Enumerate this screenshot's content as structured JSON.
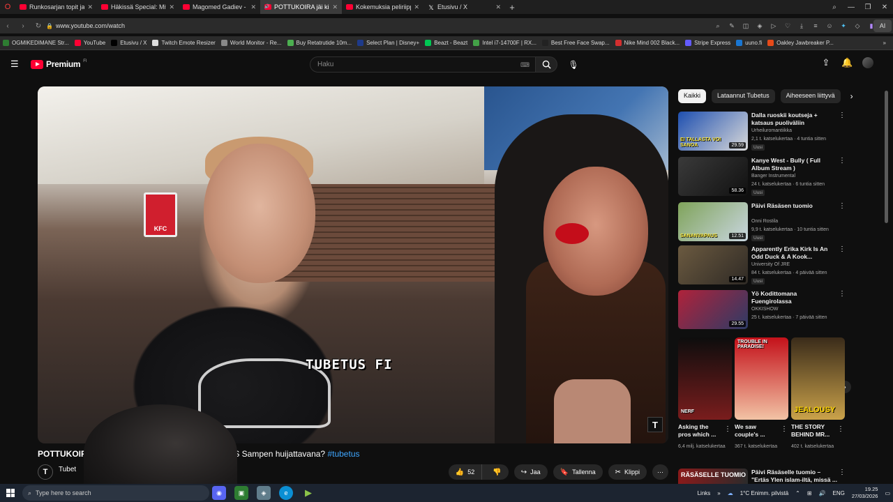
{
  "browser": {
    "tabs": [
      {
        "title": "Runkosarjan topit ja flopit",
        "favicon": "red"
      },
      {
        "title": "Häkissä Special: Mitä oikei",
        "favicon": "red"
      },
      {
        "title": "Magomed Gadiev - YouTub",
        "favicon": "red"
      },
      {
        "title": "POTTUKOIRA jäi kiinni",
        "favicon": "speaker",
        "active": true
      },
      {
        "title": "Kokemuksia peliriippuvuu",
        "favicon": "red"
      },
      {
        "title": "Etusivu / X",
        "favicon": "x"
      }
    ],
    "url": "www.youtube.com/watch",
    "ai_label": "AI",
    "bookmarks": [
      {
        "label": "OGMIKEDIMANE Str...",
        "color": "#2e7d32"
      },
      {
        "label": "YouTube",
        "color": "#ff0033"
      },
      {
        "label": "Etusivu / X",
        "color": "#000000"
      },
      {
        "label": "Twitch Emote Resizer",
        "color": "#dddddd"
      },
      {
        "label": "World Monitor - Re...",
        "color": "#888888"
      },
      {
        "label": "Buy Retatrutide 10m...",
        "color": "#4caf50"
      },
      {
        "label": "Select Plan | Disney+",
        "color": "#1e3a8a"
      },
      {
        "label": "Beazt - Beazt",
        "color": "#00c853"
      },
      {
        "label": "Intel i7-14700F | RX...",
        "color": "#43a047"
      },
      {
        "label": "Best Free Face Swap...",
        "color": "#222222"
      },
      {
        "label": "Nike Mind 002 Black...",
        "color": "#d32f2f"
      },
      {
        "label": "Stripe Express",
        "color": "#635bff"
      },
      {
        "label": "uuno.fi",
        "color": "#1976d2"
      },
      {
        "label": "Oakley Jawbreaker P...",
        "color": "#e64a19"
      }
    ]
  },
  "youtube": {
    "logo_text": "Premium",
    "logo_region": "FI",
    "search_placeholder": "Haku",
    "video": {
      "overlay_text": "TUBETUS FI",
      "title_start": "POTTUKOIR",
      "title_end": "KKIS Sampen huijattavana?",
      "hashtag": "#tubetus",
      "channel": "Tubet",
      "likes": "52",
      "share_label": "Jaa",
      "save_label": "Tallenna",
      "clip_label": "Klippi"
    },
    "chips": [
      "Kaikki",
      "Lataannut Tubetus",
      "Aiheeseen liittyvä"
    ],
    "recommendations": [
      {
        "title": "Dalla ruoskii koutseja + katsaus puoliväliin",
        "channel": "Urheilu​romantiikka",
        "meta": "2,1 t. katselukertaa · 4 tuntia sitten",
        "badge": "Uusi",
        "duration": "29.59",
        "colors": [
          "#1e4fb0",
          "#d9d9d9"
        ],
        "thumb_text": "EI TALLASTA VOI SANOA"
      },
      {
        "title": "Kanye West - Bully ( Full Album Stream )",
        "channel": "Banger Instrumental",
        "meta": "24 t. katselukertaa · 6 tuntia sitten",
        "badge": "Uusi",
        "duration": "58.36",
        "colors": [
          "#3a3a3a",
          "#111111"
        ],
        "thumb_text": ""
      },
      {
        "title": "Päivi Räsäsen tuomio",
        "channel": "Onni Rostila",
        "meta": "9,9 t. katselukertaa · 10 tuntia sitten",
        "badge": "Uusi",
        "duration": "12.51",
        "colors": [
          "#7fa35a",
          "#c9d6e0"
        ],
        "thumb_text": "SANANVAPAUS"
      },
      {
        "title": "Apparently Erika Kirk Is An Odd Duck & A Kook...",
        "channel": "University Of JRE",
        "meta": "84 t. katselukertaa · 4 päivää sitten",
        "badge": "Uusi",
        "duration": "14.47",
        "colors": [
          "#6b5a40",
          "#2f2a25"
        ],
        "thumb_text": ""
      },
      {
        "title": "Yö Kodittomana Fuengirolassa",
        "channel": "OKKISHOW",
        "meta": "25 t. katselukertaa · 7 päivää sitten",
        "badge": "",
        "duration": "29.55",
        "colors": [
          "#b0223a",
          "#2d3b66"
        ],
        "thumb_text": ""
      }
    ],
    "shorts": [
      {
        "title": "Asking the pros which ...",
        "meta": "6,4 milj. katselukertaa",
        "colors": [
          "#0d0d0d",
          "#7a1d1d"
        ],
        "tag": "NERF"
      },
      {
        "title": "We saw couple's ...",
        "meta": "367 t. katselukertaa",
        "colors": [
          "#c4111a",
          "#f2c3a5"
        ],
        "tag": "TROUBLE IN PARADISE!"
      },
      {
        "title": "THE STORY BEHIND MR...",
        "meta": "402 t. katselukertaa",
        "colors": [
          "#3a2b1a",
          "#caa24a"
        ],
        "tag": "JEALOUSY"
      }
    ],
    "last_rec": {
      "title": "Päivi Räsäselle tuomio – \"Ertäs Ylen islam-iltä, missä ...",
      "thumb_text": "RÄSÄSELLE TUOMIO"
    }
  },
  "taskbar": {
    "search_placeholder": "Type here to search",
    "links_label": "Links",
    "weather": "1°C  Enimm. pilvistä",
    "language": "ENG",
    "time": "19.25",
    "date": "27/03/2026"
  }
}
